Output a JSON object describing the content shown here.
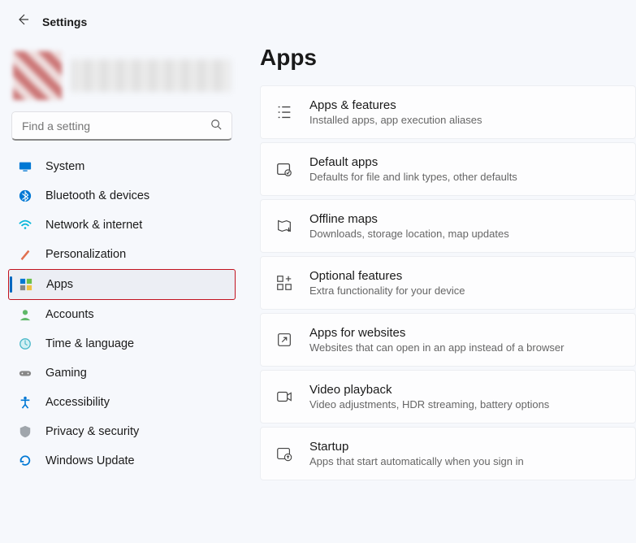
{
  "header": {
    "title": "Settings"
  },
  "search": {
    "placeholder": "Find a setting"
  },
  "sidebar": {
    "items": [
      {
        "label": "System"
      },
      {
        "label": "Bluetooth & devices"
      },
      {
        "label": "Network & internet"
      },
      {
        "label": "Personalization"
      },
      {
        "label": "Apps"
      },
      {
        "label": "Accounts"
      },
      {
        "label": "Time & language"
      },
      {
        "label": "Gaming"
      },
      {
        "label": "Accessibility"
      },
      {
        "label": "Privacy & security"
      },
      {
        "label": "Windows Update"
      }
    ]
  },
  "page": {
    "title": "Apps"
  },
  "cards": [
    {
      "title": "Apps & features",
      "desc": "Installed apps, app execution aliases"
    },
    {
      "title": "Default apps",
      "desc": "Defaults for file and link types, other defaults"
    },
    {
      "title": "Offline maps",
      "desc": "Downloads, storage location, map updates"
    },
    {
      "title": "Optional features",
      "desc": "Extra functionality for your device"
    },
    {
      "title": "Apps for websites",
      "desc": "Websites that can open in an app instead of a browser"
    },
    {
      "title": "Video playback",
      "desc": "Video adjustments, HDR streaming, battery options"
    },
    {
      "title": "Startup",
      "desc": "Apps that start automatically when you sign in"
    }
  ]
}
